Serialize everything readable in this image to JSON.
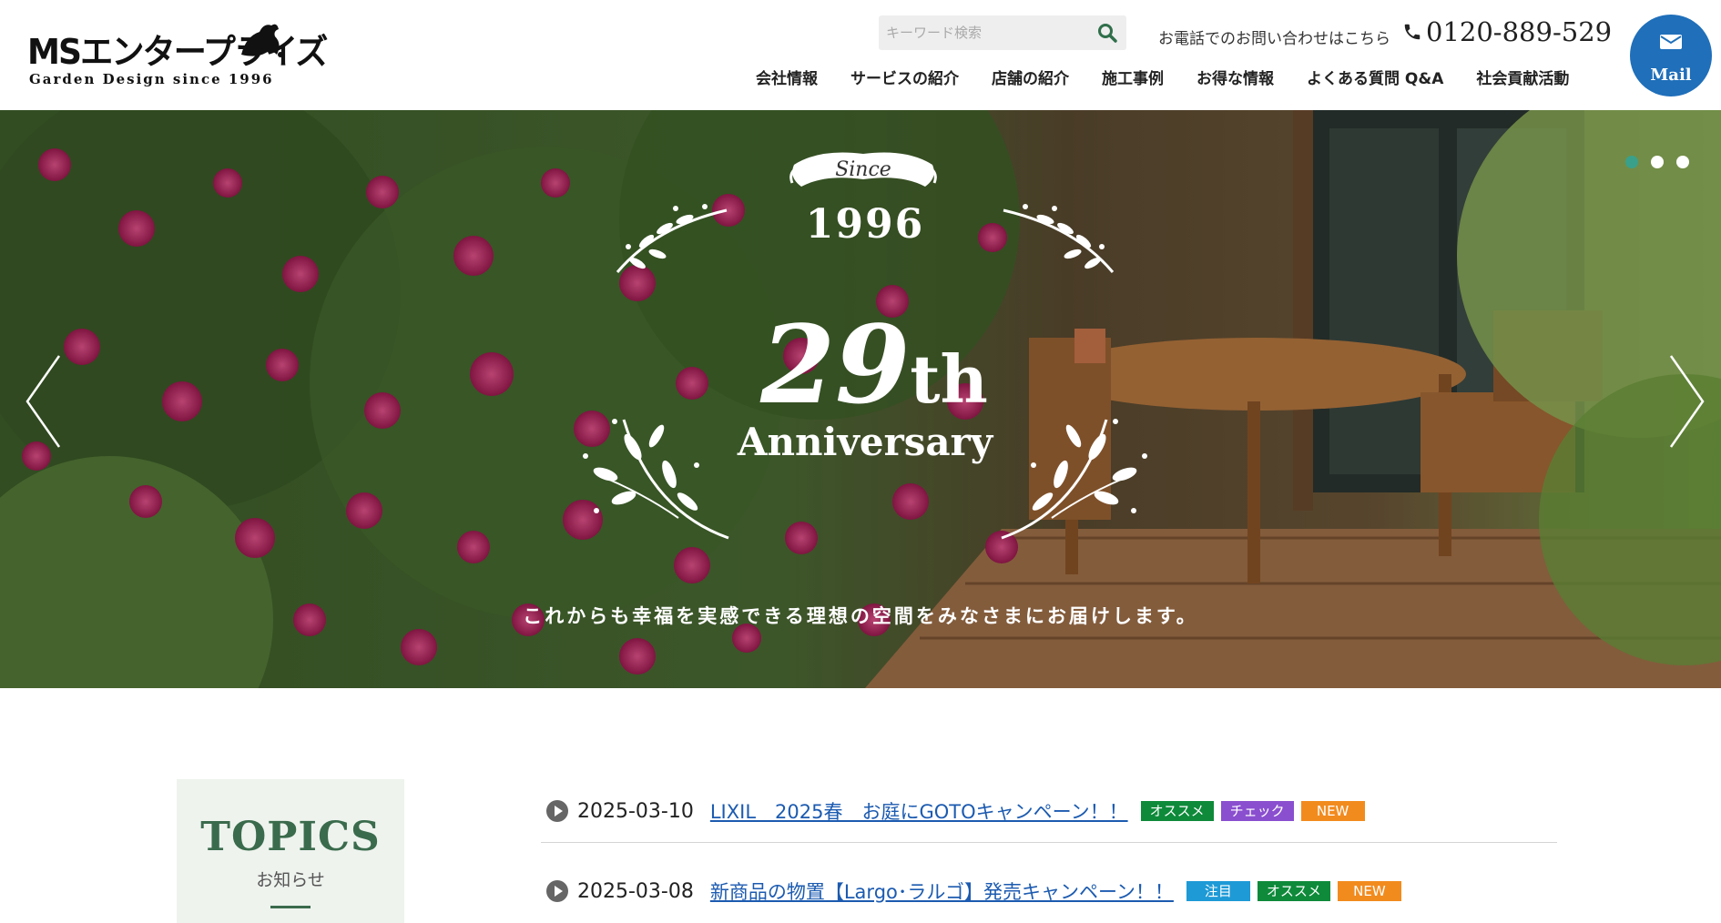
{
  "header": {
    "logo_text": "MSエンタープライズ",
    "logo_sub": "Garden Design since 1996",
    "search_placeholder": "キーワード検索",
    "phone_label": "お電話でのお問い合わせはこちら",
    "phone_number": "0120-889-529",
    "mail_label": "Mail",
    "nav": [
      {
        "label": "会社情報"
      },
      {
        "label": "サービスの紹介"
      },
      {
        "label": "店舗の紹介"
      },
      {
        "label": "施工事例"
      },
      {
        "label": "お得な情報"
      },
      {
        "label": "よくある質問 Q&A"
      },
      {
        "label": "社会貢献活動"
      }
    ]
  },
  "hero": {
    "since": "Since",
    "year": "1996",
    "anniversary_number": "29",
    "anniversary_suffix": "th",
    "anniversary_word": "Anniversary",
    "tagline": "これからも幸福を実感できる理想の空間をみなさまにお届けします。",
    "slide_count": 3,
    "active_slide": 1
  },
  "topics": {
    "title": "TOPICS",
    "subtitle": "お知らせ",
    "items": [
      {
        "date": "2025-03-10",
        "title": "LIXIL　2025春　お庭にGOTOキャンペーン！！",
        "tags": [
          {
            "label": "オススメ",
            "color": "#0e8a3a"
          },
          {
            "label": "チェック",
            "color": "#8a4fcf"
          },
          {
            "label": "NEW",
            "color": "#f28b1e"
          }
        ]
      },
      {
        "date": "2025-03-08",
        "title": "新商品の物置【Largo･ラルゴ】発売キャンペーン！！",
        "tags": [
          {
            "label": "注目",
            "color": "#1e9ad6"
          },
          {
            "label": "オススメ",
            "color": "#0e8a3a"
          },
          {
            "label": "NEW",
            "color": "#f28b1e"
          }
        ]
      }
    ]
  },
  "colors": {
    "mail_button": "#1f6fba",
    "topics_accent": "#3a6b4c",
    "link": "#1c5bb0"
  }
}
